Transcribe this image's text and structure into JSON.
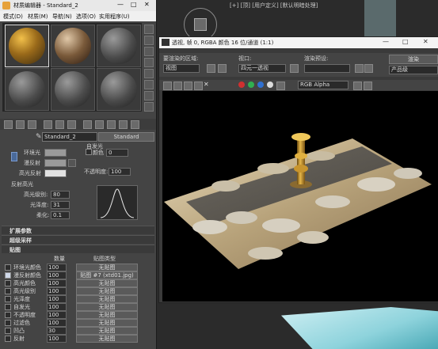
{
  "material_editor": {
    "title": "材质编辑器 - Standard_2",
    "menu": [
      "模式(D)",
      "材质(M)",
      "导航(N)",
      "选项(O)",
      "实用程序(U)"
    ],
    "material_name": "Standard_2",
    "material_type": "Standard",
    "basic": {
      "ambient_label": "环境光",
      "diffuse_label": "漫反射",
      "specular_label": "高光反射",
      "self_illum_group": "自发光",
      "color_label": "颜色",
      "color_value": "0",
      "opacity_label": "不透明度:",
      "opacity_value": "100"
    },
    "specular_highlights": {
      "title": "反射高光",
      "specular_level_label": "高光级别:",
      "specular_level_value": "80",
      "glossiness_label": "光泽度:",
      "glossiness_value": "31",
      "soften_label": "柔化:",
      "soften_value": "0.1"
    },
    "rollouts": {
      "extended": "扩展参数",
      "supersampling": "超级采样",
      "maps": "贴图"
    },
    "maps_header": {
      "amount": "数量",
      "map_type": "贴图类型"
    },
    "maps": [
      {
        "name": "环境光颜色",
        "amount": "100",
        "map": "无贴图",
        "checked": false
      },
      {
        "name": "漫反射颜色",
        "amount": "100",
        "map": "贴图 #7 (xtd01.jpg)",
        "checked": true
      },
      {
        "name": "高光颜色",
        "amount": "100",
        "map": "无贴图",
        "checked": false
      },
      {
        "name": "高光级别",
        "amount": "100",
        "map": "无贴图",
        "checked": false
      },
      {
        "name": "光泽度",
        "amount": "100",
        "map": "无贴图",
        "checked": false
      },
      {
        "name": "自发光",
        "amount": "100",
        "map": "无贴图",
        "checked": false
      },
      {
        "name": "不透明度",
        "amount": "100",
        "map": "无贴图",
        "checked": false
      },
      {
        "name": "过滤色",
        "amount": "100",
        "map": "无贴图",
        "checked": false
      },
      {
        "name": "凹凸",
        "amount": "30",
        "map": "无贴图",
        "checked": false
      },
      {
        "name": "反射",
        "amount": "100",
        "map": "无贴图",
        "checked": false
      }
    ]
  },
  "viewport": {
    "label": "[+] [顶] [用户定义] [默认明暗处理]"
  },
  "render_frame": {
    "title": "透视, 帧 0, RGBA 颜色 16 位/通道 (1:1)",
    "area_label": "要渲染的区域:",
    "area_value": "视图",
    "viewport_label": "视口:",
    "viewport_value": "四元一透视",
    "preset_label": "渲染预设:",
    "preset_value": "",
    "render_button": "渲染",
    "product_value": "产品级",
    "channel_value": "RGB Alpha",
    "colors": {
      "red": "#d03030",
      "green": "#30b050",
      "blue": "#3070d0"
    }
  },
  "window_controls": {
    "min": "—",
    "max": "□",
    "close": "✕"
  }
}
